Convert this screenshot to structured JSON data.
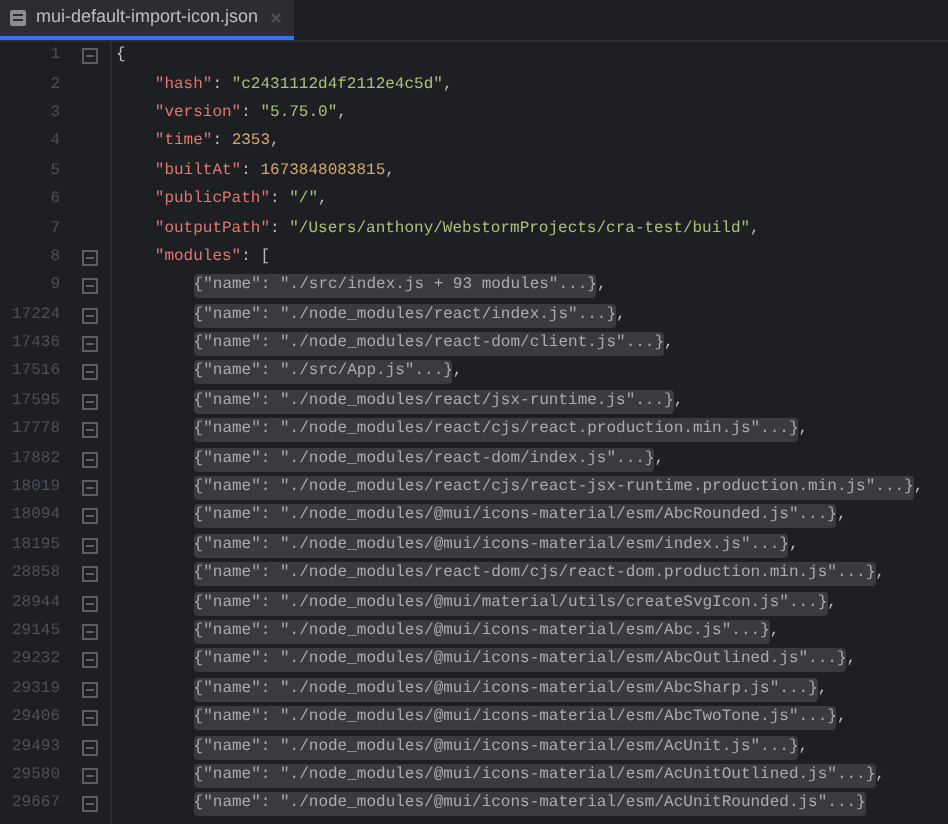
{
  "tab": {
    "title": "mui-default-import-icon.json",
    "selected": true
  },
  "lines": [
    {
      "number": "1",
      "fold_marker": true,
      "tokens": [
        {
          "kind": "punct",
          "text": "{"
        }
      ],
      "children": [
        {
          "number": "2",
          "fold_marker": false,
          "tokens": [
            {
              "kind": "key",
              "text": "\"hash\""
            },
            {
              "kind": "punct",
              "text": ": "
            },
            {
              "kind": "string",
              "text": "\"c2431112d4f2112e4c5d\""
            },
            {
              "kind": "punct",
              "text": ","
            }
          ]
        },
        {
          "number": "3",
          "fold_marker": false,
          "tokens": [
            {
              "kind": "key",
              "text": "\"version\""
            },
            {
              "kind": "punct",
              "text": ": "
            },
            {
              "kind": "string",
              "text": "\"5.75.0\""
            },
            {
              "kind": "punct",
              "text": ","
            }
          ]
        },
        {
          "number": "4",
          "fold_marker": false,
          "tokens": [
            {
              "kind": "key",
              "text": "\"time\""
            },
            {
              "kind": "punct",
              "text": ": "
            },
            {
              "kind": "number",
              "text": "2353"
            },
            {
              "kind": "punct",
              "text": ","
            }
          ]
        },
        {
          "number": "5",
          "fold_marker": false,
          "tokens": [
            {
              "kind": "key",
              "text": "\"builtAt\""
            },
            {
              "kind": "punct",
              "text": ": "
            },
            {
              "kind": "number",
              "text": "1673848083815"
            },
            {
              "kind": "punct",
              "text": ","
            }
          ]
        },
        {
          "number": "6",
          "fold_marker": false,
          "tokens": [
            {
              "kind": "key",
              "text": "\"publicPath\""
            },
            {
              "kind": "punct",
              "text": ": "
            },
            {
              "kind": "string",
              "text": "\"/\""
            },
            {
              "kind": "punct",
              "text": ","
            }
          ]
        },
        {
          "number": "7",
          "fold_marker": false,
          "tokens": [
            {
              "kind": "key",
              "text": "\"outputPath\""
            },
            {
              "kind": "punct",
              "text": ": "
            },
            {
              "kind": "string",
              "text": "\"/Users/anthony/WebstormProjects/cra-test/build\""
            },
            {
              "kind": "punct",
              "text": ","
            }
          ]
        },
        {
          "number": "8",
          "fold_marker": true,
          "tokens": [
            {
              "kind": "key",
              "text": "\"modules\""
            },
            {
              "kind": "punct",
              "text": ": ["
            }
          ],
          "children": [
            {
              "number": "9",
              "fold_marker": true,
              "tokens": [
                {
                  "kind": "fold",
                  "text": "{\"name\": \"./src/index.js + 93 modules\"...}"
                },
                {
                  "kind": "punct",
                  "text": ","
                }
              ]
            },
            {
              "number": "17224",
              "fold_marker": true,
              "tokens": [
                {
                  "kind": "fold",
                  "text": "{\"name\": \"./node_modules/react/index.js\"...}"
                },
                {
                  "kind": "punct",
                  "text": ","
                }
              ]
            },
            {
              "number": "17436",
              "fold_marker": true,
              "tokens": [
                {
                  "kind": "fold",
                  "text": "{\"name\": \"./node_modules/react-dom/client.js\"...}"
                },
                {
                  "kind": "punct",
                  "text": ","
                }
              ]
            },
            {
              "number": "17516",
              "fold_marker": true,
              "tokens": [
                {
                  "kind": "fold",
                  "text": "{\"name\": \"./src/App.js\"...}"
                },
                {
                  "kind": "punct",
                  "text": ","
                }
              ]
            },
            {
              "number": "17595",
              "fold_marker": true,
              "tokens": [
                {
                  "kind": "fold",
                  "text": "{\"name\": \"./node_modules/react/jsx-runtime.js\"...}"
                },
                {
                  "kind": "punct",
                  "text": ","
                }
              ]
            },
            {
              "number": "17778",
              "fold_marker": true,
              "tokens": [
                {
                  "kind": "fold",
                  "text": "{\"name\": \"./node_modules/react/cjs/react.production.min.js\"...}"
                },
                {
                  "kind": "punct",
                  "text": ","
                }
              ]
            },
            {
              "number": "17882",
              "fold_marker": true,
              "tokens": [
                {
                  "kind": "fold",
                  "text": "{\"name\": \"./node_modules/react-dom/index.js\"...}"
                },
                {
                  "kind": "punct",
                  "text": ","
                }
              ]
            },
            {
              "number": "18019",
              "fold_marker": true,
              "tokens": [
                {
                  "kind": "fold",
                  "text": "{\"name\": \"./node_modules/react/cjs/react-jsx-runtime.production.min.js\"...}"
                },
                {
                  "kind": "punct",
                  "text": ","
                }
              ]
            },
            {
              "number": "18094",
              "fold_marker": true,
              "tokens": [
                {
                  "kind": "fold",
                  "text": "{\"name\": \"./node_modules/@mui/icons-material/esm/AbcRounded.js\"...}"
                },
                {
                  "kind": "punct",
                  "text": ","
                }
              ]
            },
            {
              "number": "18195",
              "fold_marker": true,
              "tokens": [
                {
                  "kind": "fold",
                  "text": "{\"name\": \"./node_modules/@mui/icons-material/esm/index.js\"...}"
                },
                {
                  "kind": "punct",
                  "text": ","
                }
              ]
            },
            {
              "number": "28858",
              "fold_marker": true,
              "tokens": [
                {
                  "kind": "fold",
                  "text": "{\"name\": \"./node_modules/react-dom/cjs/react-dom.production.min.js\"...}"
                },
                {
                  "kind": "punct",
                  "text": ","
                }
              ]
            },
            {
              "number": "28944",
              "fold_marker": true,
              "tokens": [
                {
                  "kind": "fold",
                  "text": "{\"name\": \"./node_modules/@mui/material/utils/createSvgIcon.js\"...}"
                },
                {
                  "kind": "punct",
                  "text": ","
                }
              ]
            },
            {
              "number": "29145",
              "fold_marker": true,
              "tokens": [
                {
                  "kind": "fold",
                  "text": "{\"name\": \"./node_modules/@mui/icons-material/esm/Abc.js\"...}"
                },
                {
                  "kind": "punct",
                  "text": ","
                }
              ]
            },
            {
              "number": "29232",
              "fold_marker": true,
              "tokens": [
                {
                  "kind": "fold",
                  "text": "{\"name\": \"./node_modules/@mui/icons-material/esm/AbcOutlined.js\"...}"
                },
                {
                  "kind": "punct",
                  "text": ","
                }
              ]
            },
            {
              "number": "29319",
              "fold_marker": true,
              "tokens": [
                {
                  "kind": "fold",
                  "text": "{\"name\": \"./node_modules/@mui/icons-material/esm/AbcSharp.js\"...}"
                },
                {
                  "kind": "punct",
                  "text": ","
                }
              ]
            },
            {
              "number": "29406",
              "fold_marker": true,
              "tokens": [
                {
                  "kind": "fold",
                  "text": "{\"name\": \"./node_modules/@mui/icons-material/esm/AbcTwoTone.js\"...}"
                },
                {
                  "kind": "punct",
                  "text": ","
                }
              ]
            },
            {
              "number": "29493",
              "fold_marker": true,
              "tokens": [
                {
                  "kind": "fold",
                  "text": "{\"name\": \"./node_modules/@mui/icons-material/esm/AcUnit.js\"...}"
                },
                {
                  "kind": "punct",
                  "text": ","
                }
              ]
            },
            {
              "number": "29580",
              "fold_marker": true,
              "tokens": [
                {
                  "kind": "fold",
                  "text": "{\"name\": \"./node_modules/@mui/icons-material/esm/AcUnitOutlined.js\"...}"
                },
                {
                  "kind": "punct",
                  "text": ","
                }
              ]
            },
            {
              "number": "29667",
              "fold_marker": true,
              "tokens": [
                {
                  "kind": "fold",
                  "text": "{\"name\": \"./node_modules/@mui/icons-material/esm/AcUnitRounded.js\"...}"
                }
              ]
            }
          ]
        }
      ]
    }
  ]
}
